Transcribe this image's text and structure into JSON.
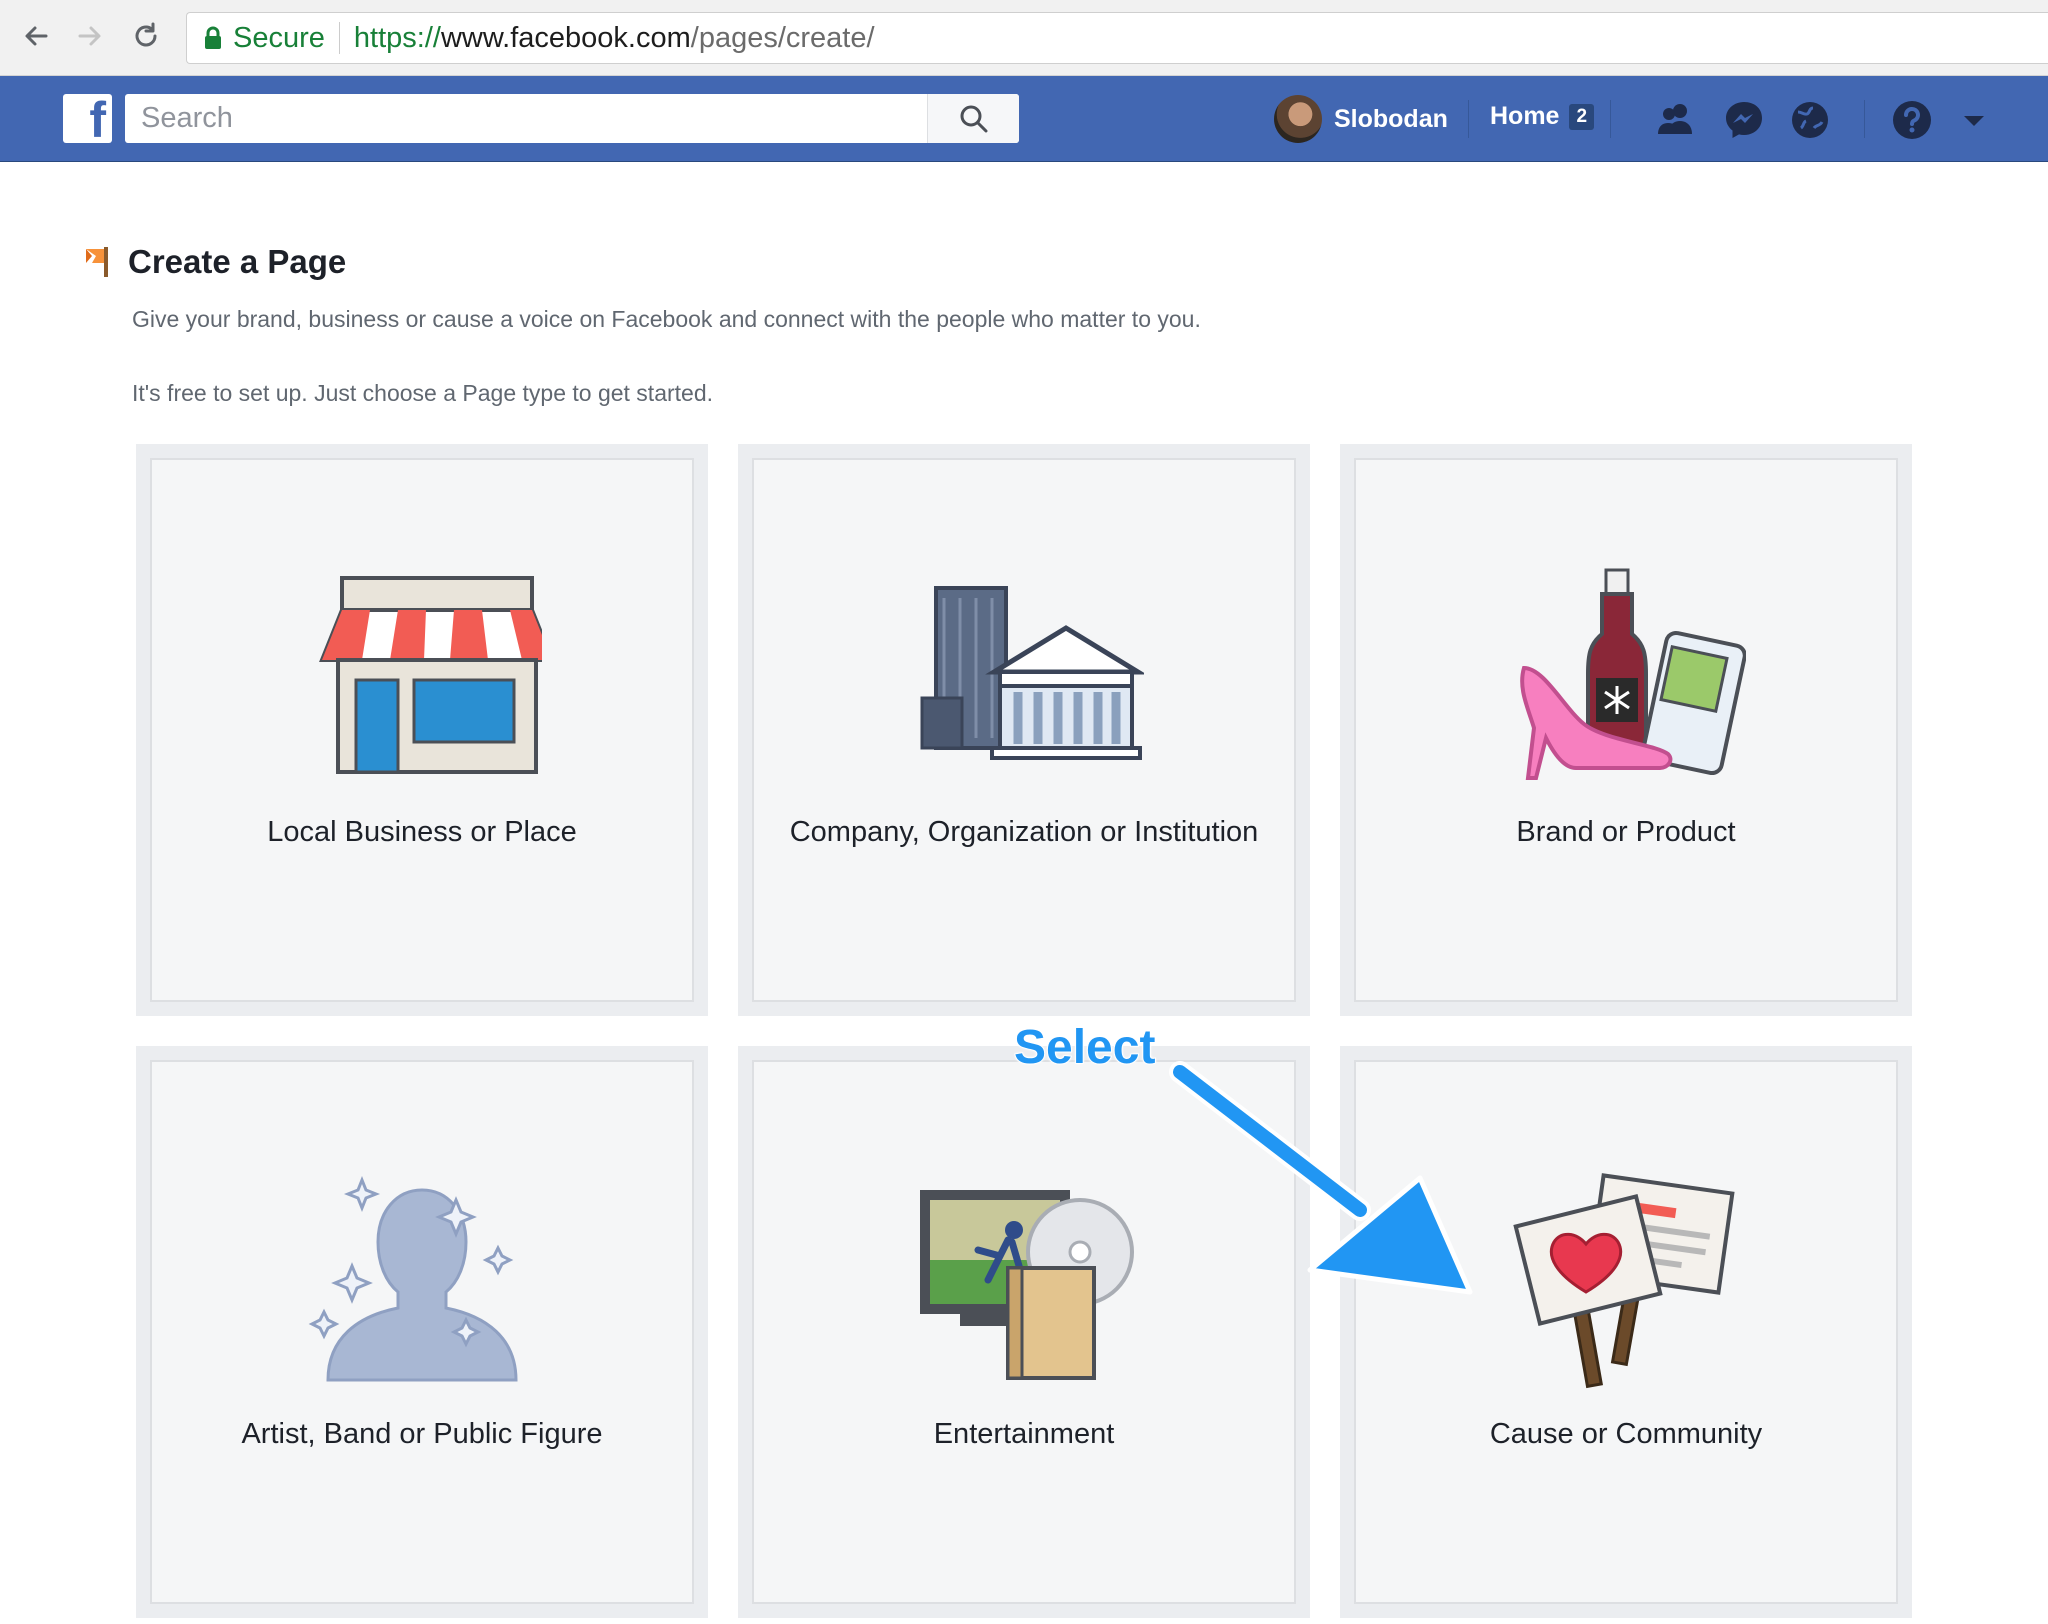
{
  "browser": {
    "secure_label": "Secure",
    "url_scheme": "https://",
    "url_host": "www.facebook.com",
    "url_path": "/pages/create/"
  },
  "header": {
    "search_placeholder": "Search",
    "user_name": "Slobodan",
    "home_label": "Home",
    "home_count": "2"
  },
  "page": {
    "title": "Create a Page",
    "description": "Give your brand, business or cause a voice on Facebook and connect with the people who matter to you.",
    "subdescription": "It's free to set up. Just choose a Page type to get started."
  },
  "categories": [
    {
      "label": "Local Business or Place",
      "icon": "storefront-icon"
    },
    {
      "label": "Company, Organization or Institution",
      "icon": "building-icon"
    },
    {
      "label": "Brand or Product",
      "icon": "products-icon"
    },
    {
      "label": "Artist, Band or Public Figure",
      "icon": "person-silhouette-icon"
    },
    {
      "label": "Entertainment",
      "icon": "tv-media-icon"
    },
    {
      "label": "Cause or Community",
      "icon": "protest-signs-icon"
    }
  ],
  "annotation": {
    "label": "Select",
    "color": "#2196f3"
  },
  "colors": {
    "fb_blue": "#4267b2",
    "secure_green": "#188038"
  }
}
